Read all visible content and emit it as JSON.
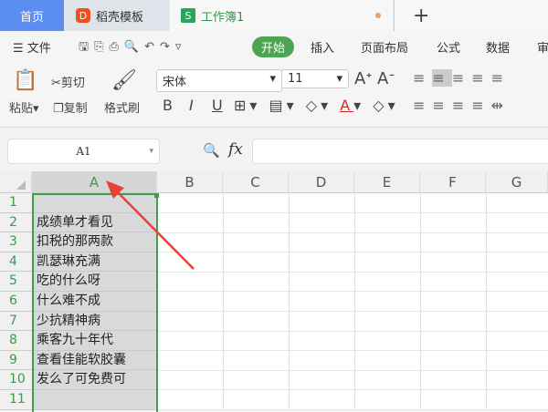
{
  "tabs": {
    "home": "首页",
    "template": "稻壳模板",
    "workbook": "工作簿1",
    "plus": "+"
  },
  "menu": {
    "file": "文件",
    "start": "开始",
    "insert": "插入",
    "layout": "页面布局",
    "formula": "公式",
    "data": "数据",
    "review": "审"
  },
  "ribbon": {
    "paste": "粘贴",
    "cut": "剪切",
    "copy": "复制",
    "format_painter": "格式刷",
    "font": "宋体",
    "size": "11",
    "bold": "B",
    "italic": "I",
    "underline": "U"
  },
  "formula": {
    "name_box": "A1",
    "fx": "fx"
  },
  "columns": [
    "A",
    "B",
    "C",
    "D",
    "E",
    "F",
    "G"
  ],
  "rows": [
    {
      "n": "1",
      "a": ""
    },
    {
      "n": "2",
      "a": "成绩单才看见"
    },
    {
      "n": "3",
      "a": "扣税的那两款"
    },
    {
      "n": "4",
      "a": "凯瑟琳充满"
    },
    {
      "n": "5",
      "a": "吃的什么呀"
    },
    {
      "n": "6",
      "a": "什么难不成"
    },
    {
      "n": "7",
      "a": "少抗精神病"
    },
    {
      "n": "8",
      "a": "乘客九十年代"
    },
    {
      "n": "9",
      "a": "查看佳能软胶囊"
    },
    {
      "n": "10",
      "a": "发么了可免费可"
    },
    {
      "n": "11",
      "a": ""
    }
  ],
  "colors": {
    "accent": "#4da553",
    "arrow": "#e8413a"
  }
}
